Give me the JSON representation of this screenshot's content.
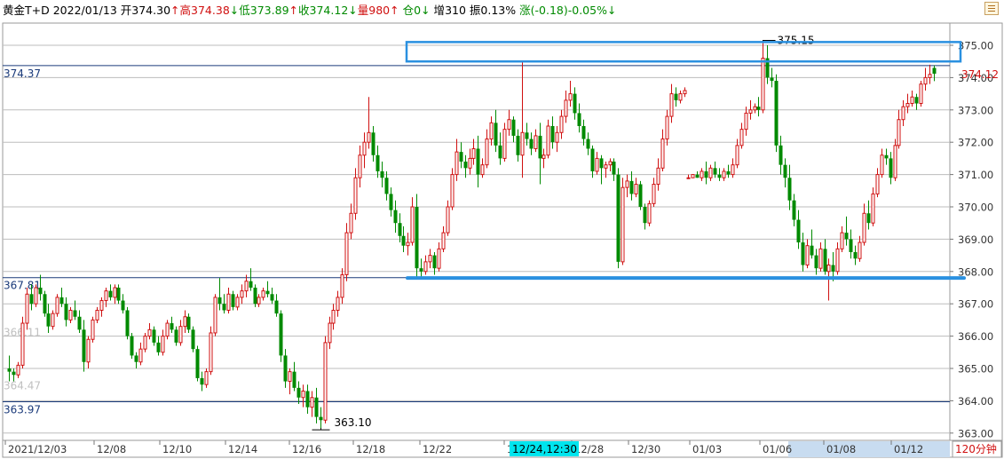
{
  "header": {
    "instrument": "黄金T+D",
    "date": "2022/01/13",
    "open_label": "开",
    "open_value": "374.30",
    "open_arrow": "↑",
    "high_label": "高",
    "high_value": "374.38",
    "high_arrow": "↓",
    "low_label": "低",
    "low_value": "373.89",
    "low_arrow": "↑",
    "close_label": "收",
    "close_value": "374.12",
    "close_arrow": "↓",
    "volume_label": "量",
    "volume_value": "980",
    "volume_arrow": "↑",
    "oi_label": "仓",
    "oi_value": "0",
    "oi_arrow": "↓",
    "increase_label": "增",
    "increase_value": "310",
    "amplitude_label": "振",
    "amplitude_value": "0.13%",
    "change_label": "涨",
    "change_value": "(-0.18)-0.05%",
    "change_arrow": "↓"
  },
  "period_label": "120分钟",
  "crosshair_time_label": "12/24,12:30",
  "colors": {
    "up": "#d01010",
    "down": "#008a00",
    "grid": "#bdbdbd",
    "ref_line": "#1a3a7a",
    "annotation": "#2a90e0",
    "axis_highlight": "#00e5ee",
    "axis_band": "#c8dcf0"
  },
  "chart_data": {
    "type": "candlestick",
    "y_ticks": [
      "375.00",
      "374.00",
      "373.00",
      "372.00",
      "371.00",
      "370.00",
      "369.00",
      "368.00",
      "367.00",
      "366.00",
      "365.00",
      "364.00",
      "363.00"
    ],
    "ylim": [
      362.8,
      375.9
    ],
    "x_tick_labels": [
      "2021/12/03",
      "12/08",
      "12/10",
      "12/14",
      "12/16",
      "12/18",
      "12/22",
      "12/24",
      "12/28",
      "12/30",
      "01/03",
      "01/06",
      "01/08",
      "01/12"
    ],
    "current_price": "374.12",
    "reference_lines": [
      {
        "value": 374.37,
        "label": "374.37"
      },
      {
        "value": 367.81,
        "label": "367.81"
      },
      {
        "value": 363.97,
        "label": "363.97"
      }
    ],
    "faded_labels": [
      {
        "value": 366.11,
        "label": "366.11"
      },
      {
        "value": 364.47,
        "label": "364.47"
      }
    ],
    "annotations": [
      {
        "kind": "box",
        "y_low": 374.5,
        "y_high": 375.1
      },
      {
        "kind": "line",
        "value": 367.8
      }
    ],
    "price_marks": [
      {
        "label": "375.15",
        "value": 375.15
      },
      {
        "label": "363.10",
        "value": 363.1
      }
    ],
    "candles": [
      [
        365.0,
        365.4,
        364.6,
        364.9
      ],
      [
        364.9,
        365.0,
        364.6,
        364.8
      ],
      [
        364.8,
        365.2,
        364.7,
        365.1
      ],
      [
        365.1,
        366.6,
        365.0,
        366.4
      ],
      [
        366.4,
        367.5,
        366.2,
        367.3
      ],
      [
        367.3,
        367.6,
        366.8,
        367.0
      ],
      [
        367.0,
        367.6,
        366.9,
        367.5
      ],
      [
        367.5,
        367.9,
        367.1,
        367.3
      ],
      [
        367.3,
        367.4,
        366.6,
        366.7
      ],
      [
        366.7,
        367.0,
        366.1,
        366.3
      ],
      [
        366.3,
        366.8,
        366.2,
        366.7
      ],
      [
        366.7,
        367.3,
        366.6,
        367.2
      ],
      [
        367.2,
        367.5,
        366.9,
        367.0
      ],
      [
        367.0,
        367.2,
        366.3,
        366.5
      ],
      [
        366.5,
        366.9,
        366.4,
        366.8
      ],
      [
        366.8,
        367.1,
        366.5,
        366.6
      ],
      [
        366.6,
        366.8,
        366.1,
        366.2
      ],
      [
        366.2,
        366.5,
        364.9,
        365.2
      ],
      [
        365.2,
        366.0,
        365.0,
        365.9
      ],
      [
        365.9,
        366.6,
        365.8,
        366.5
      ],
      [
        366.5,
        366.9,
        366.4,
        366.8
      ],
      [
        366.8,
        367.2,
        366.6,
        367.1
      ],
      [
        367.1,
        367.5,
        366.9,
        367.4
      ],
      [
        367.4,
        367.6,
        367.1,
        367.2
      ],
      [
        367.2,
        367.6,
        367.0,
        367.5
      ],
      [
        367.5,
        367.6,
        367.0,
        367.1
      ],
      [
        367.1,
        367.3,
        366.7,
        366.8
      ],
      [
        366.8,
        366.9,
        365.9,
        366.0
      ],
      [
        366.0,
        366.1,
        365.3,
        365.4
      ],
      [
        365.4,
        365.5,
        365.0,
        365.2
      ],
      [
        365.2,
        365.8,
        365.1,
        365.6
      ],
      [
        365.6,
        366.1,
        365.5,
        366.0
      ],
      [
        366.0,
        366.4,
        365.9,
        366.2
      ],
      [
        366.2,
        366.3,
        365.7,
        365.8
      ],
      [
        365.8,
        366.0,
        365.4,
        365.5
      ],
      [
        365.5,
        366.2,
        365.4,
        366.0
      ],
      [
        366.0,
        366.5,
        365.9,
        366.4
      ],
      [
        366.4,
        366.6,
        366.1,
        366.2
      ],
      [
        366.2,
        366.3,
        365.7,
        365.8
      ],
      [
        365.8,
        366.5,
        365.7,
        366.3
      ],
      [
        366.3,
        366.8,
        366.1,
        366.6
      ],
      [
        366.6,
        366.7,
        366.1,
        366.2
      ],
      [
        366.2,
        366.3,
        365.5,
        365.6
      ],
      [
        365.6,
        365.7,
        364.6,
        364.7
      ],
      [
        364.7,
        364.9,
        364.3,
        364.5
      ],
      [
        364.5,
        365.0,
        364.4,
        364.9
      ],
      [
        364.9,
        366.3,
        364.8,
        366.1
      ],
      [
        366.1,
        367.3,
        366.0,
        367.2
      ],
      [
        367.2,
        367.8,
        366.8,
        367.0
      ],
      [
        367.0,
        367.3,
        366.7,
        366.8
      ],
      [
        366.8,
        367.5,
        366.7,
        367.3
      ],
      [
        367.3,
        367.4,
        366.8,
        366.9
      ],
      [
        366.9,
        367.3,
        366.8,
        367.2
      ],
      [
        367.2,
        367.6,
        367.0,
        367.4
      ],
      [
        367.4,
        367.9,
        367.2,
        367.7
      ],
      [
        367.7,
        368.1,
        367.4,
        367.5
      ],
      [
        367.5,
        367.6,
        366.9,
        367.0
      ],
      [
        367.0,
        367.3,
        366.9,
        367.2
      ],
      [
        367.2,
        367.5,
        367.1,
        367.4
      ],
      [
        367.4,
        367.7,
        367.2,
        367.3
      ],
      [
        367.3,
        367.5,
        367.0,
        367.1
      ],
      [
        367.1,
        367.3,
        366.6,
        366.7
      ],
      [
        366.7,
        366.8,
        365.2,
        365.4
      ],
      [
        365.4,
        365.6,
        364.4,
        364.6
      ],
      [
        364.6,
        365.0,
        364.2,
        364.9
      ],
      [
        364.9,
        365.2,
        364.3,
        364.4
      ],
      [
        364.4,
        364.6,
        363.9,
        364.1
      ],
      [
        364.1,
        364.5,
        363.8,
        364.3
      ],
      [
        364.3,
        364.5,
        363.6,
        363.8
      ],
      [
        363.8,
        364.3,
        363.5,
        364.1
      ],
      [
        364.1,
        364.4,
        363.3,
        363.5
      ],
      [
        363.5,
        363.8,
        363.1,
        363.4
      ],
      [
        363.4,
        366.0,
        363.3,
        365.8
      ],
      [
        365.8,
        366.6,
        365.6,
        366.4
      ],
      [
        366.4,
        367.0,
        366.2,
        366.8
      ],
      [
        366.8,
        367.4,
        366.6,
        367.2
      ],
      [
        367.2,
        368.1,
        367.0,
        367.9
      ],
      [
        367.9,
        369.5,
        367.7,
        369.2
      ],
      [
        369.2,
        370.1,
        369.0,
        369.8
      ],
      [
        369.8,
        371.2,
        369.6,
        370.9
      ],
      [
        370.9,
        371.9,
        370.6,
        371.6
      ],
      [
        371.6,
        372.3,
        371.2,
        372.0
      ],
      [
        372.0,
        373.4,
        371.8,
        372.3
      ],
      [
        372.3,
        372.5,
        371.4,
        371.6
      ],
      [
        371.6,
        371.9,
        370.9,
        371.1
      ],
      [
        371.1,
        371.4,
        370.6,
        370.9
      ],
      [
        370.9,
        371.1,
        370.2,
        370.4
      ],
      [
        370.4,
        370.6,
        369.7,
        369.9
      ],
      [
        369.9,
        370.2,
        369.2,
        369.5
      ],
      [
        369.5,
        369.8,
        368.9,
        369.1
      ],
      [
        369.1,
        369.4,
        368.6,
        368.8
      ],
      [
        368.8,
        369.2,
        368.5,
        368.9
      ],
      [
        368.9,
        370.3,
        368.8,
        370.0
      ],
      [
        370.0,
        370.4,
        367.8,
        368.1
      ],
      [
        368.1,
        368.4,
        367.8,
        368.0
      ],
      [
        368.0,
        368.5,
        367.9,
        368.3
      ],
      [
        368.3,
        368.7,
        368.1,
        368.5
      ],
      [
        368.5,
        368.6,
        367.9,
        368.1
      ],
      [
        368.1,
        368.9,
        368.0,
        368.7
      ],
      [
        368.7,
        369.4,
        368.6,
        369.2
      ],
      [
        369.2,
        370.2,
        369.1,
        370.0
      ],
      [
        370.0,
        371.2,
        369.9,
        371.0
      ],
      [
        371.0,
        372.1,
        370.8,
        371.7
      ],
      [
        371.7,
        372.0,
        371.2,
        371.4
      ],
      [
        371.4,
        371.6,
        370.9,
        371.2
      ],
      [
        371.2,
        371.8,
        371.0,
        371.5
      ],
      [
        371.5,
        372.1,
        371.3,
        371.8
      ],
      [
        371.8,
        372.2,
        370.6,
        371.0
      ],
      [
        371.0,
        371.5,
        370.9,
        371.3
      ],
      [
        371.3,
        372.4,
        371.2,
        372.1
      ],
      [
        372.1,
        372.8,
        371.9,
        372.6
      ],
      [
        372.6,
        373.0,
        371.7,
        371.9
      ],
      [
        371.9,
        372.3,
        371.3,
        371.5
      ],
      [
        371.5,
        372.6,
        371.4,
        372.4
      ],
      [
        372.4,
        373.0,
        372.2,
        372.7
      ],
      [
        372.7,
        372.8,
        372.0,
        372.2
      ],
      [
        372.2,
        372.4,
        371.4,
        371.6
      ],
      [
        371.6,
        374.5,
        370.9,
        372.3
      ],
      [
        372.3,
        372.6,
        371.9,
        372.1
      ],
      [
        372.1,
        372.3,
        371.6,
        371.8
      ],
      [
        371.8,
        372.4,
        371.7,
        372.2
      ],
      [
        372.2,
        372.6,
        370.7,
        371.5
      ],
      [
        371.5,
        371.8,
        371.2,
        371.6
      ],
      [
        371.6,
        372.7,
        371.5,
        372.5
      ],
      [
        372.5,
        372.8,
        371.8,
        372.0
      ],
      [
        372.0,
        372.5,
        371.7,
        372.3
      ],
      [
        372.3,
        373.0,
        372.1,
        372.8
      ],
      [
        372.8,
        373.6,
        372.6,
        373.3
      ],
      [
        373.3,
        373.9,
        373.1,
        373.5
      ],
      [
        373.5,
        373.7,
        372.7,
        372.9
      ],
      [
        372.9,
        373.2,
        372.3,
        372.5
      ],
      [
        372.5,
        372.7,
        371.9,
        372.1
      ],
      [
        372.1,
        372.3,
        371.6,
        371.8
      ],
      [
        371.8,
        371.9,
        370.9,
        371.1
      ],
      [
        371.1,
        371.7,
        371.0,
        371.5
      ],
      [
        371.5,
        371.6,
        370.7,
        371.2
      ],
      [
        371.2,
        371.4,
        370.9,
        371.3
      ],
      [
        371.3,
        371.5,
        371.1,
        371.4
      ],
      [
        371.4,
        371.5,
        370.8,
        371.0
      ],
      [
        371.0,
        371.2,
        368.1,
        368.3
      ],
      [
        368.3,
        370.9,
        368.2,
        370.6
      ],
      [
        370.6,
        371.0,
        370.3,
        370.8
      ],
      [
        370.8,
        371.1,
        370.2,
        370.4
      ],
      [
        370.4,
        370.9,
        370.3,
        370.7
      ],
      [
        370.7,
        370.8,
        369.9,
        370.0
      ],
      [
        370.0,
        370.1,
        369.3,
        369.5
      ],
      [
        369.5,
        370.2,
        369.4,
        370.1
      ],
      [
        370.1,
        370.9,
        370.0,
        370.7
      ],
      [
        370.7,
        371.5,
        370.5,
        371.2
      ],
      [
        371.2,
        372.4,
        371.1,
        372.1
      ],
      [
        372.1,
        373.0,
        371.9,
        372.8
      ],
      [
        372.8,
        373.8,
        372.6,
        373.5
      ],
      [
        373.5,
        373.7,
        373.1,
        373.3
      ],
      [
        373.3,
        373.6,
        373.2,
        373.5
      ],
      [
        373.5,
        373.7,
        373.4,
        373.6
      ],
      [
        370.9,
        371.0,
        370.9,
        370.9
      ],
      [
        370.9,
        371.0,
        370.9,
        371.0
      ],
      [
        371.0,
        371.1,
        370.9,
        370.9
      ],
      [
        370.9,
        371.2,
        370.8,
        371.1
      ],
      [
        371.1,
        371.4,
        370.7,
        370.9
      ],
      [
        370.9,
        371.3,
        370.8,
        371.2
      ],
      [
        371.2,
        371.4,
        370.9,
        371.0
      ],
      [
        371.0,
        371.2,
        370.8,
        370.9
      ],
      [
        370.9,
        371.2,
        370.8,
        371.1
      ],
      [
        371.1,
        371.3,
        370.9,
        371.0
      ],
      [
        371.0,
        371.5,
        370.9,
        371.3
      ],
      [
        371.3,
        372.1,
        371.2,
        371.9
      ],
      [
        371.9,
        372.6,
        371.8,
        372.4
      ],
      [
        372.4,
        373.1,
        372.2,
        372.9
      ],
      [
        372.9,
        373.3,
        372.7,
        373.0
      ],
      [
        373.0,
        373.2,
        372.9,
        373.1
      ],
      [
        373.1,
        373.4,
        372.8,
        373.0
      ],
      [
        373.0,
        375.15,
        372.9,
        374.6
      ],
      [
        374.6,
        375.0,
        373.8,
        374.0
      ],
      [
        374.0,
        374.3,
        373.7,
        373.9
      ],
      [
        373.9,
        374.1,
        371.7,
        371.9
      ],
      [
        371.9,
        372.2,
        371.0,
        371.3
      ],
      [
        371.3,
        371.5,
        370.6,
        370.9
      ],
      [
        370.9,
        371.3,
        369.9,
        370.2
      ],
      [
        370.2,
        370.4,
        369.4,
        369.6
      ],
      [
        369.6,
        369.9,
        368.7,
        368.9
      ],
      [
        368.9,
        369.2,
        368.0,
        368.2
      ],
      [
        368.2,
        369.0,
        368.1,
        368.8
      ],
      [
        368.8,
        369.3,
        368.4,
        368.5
      ],
      [
        368.5,
        368.7,
        367.9,
        368.1
      ],
      [
        368.1,
        368.9,
        368.0,
        368.7
      ],
      [
        368.7,
        369.0,
        367.9,
        368.0
      ],
      [
        368.0,
        368.4,
        367.1,
        368.2
      ],
      [
        368.2,
        368.6,
        367.7,
        368.0
      ],
      [
        368.0,
        368.9,
        367.9,
        368.7
      ],
      [
        368.7,
        369.4,
        368.6,
        369.2
      ],
      [
        369.2,
        369.7,
        368.8,
        369.0
      ],
      [
        369.0,
        369.3,
        368.4,
        368.6
      ],
      [
        368.6,
        368.8,
        368.2,
        368.4
      ],
      [
        368.4,
        369.1,
        368.3,
        368.9
      ],
      [
        368.9,
        370.1,
        368.8,
        369.8
      ],
      [
        369.8,
        370.2,
        369.3,
        369.5
      ],
      [
        369.5,
        370.6,
        369.4,
        370.4
      ],
      [
        370.4,
        371.2,
        370.3,
        371.0
      ],
      [
        371.0,
        371.8,
        370.9,
        371.6
      ],
      [
        371.6,
        371.8,
        371.3,
        371.5
      ],
      [
        371.5,
        371.7,
        370.7,
        370.9
      ],
      [
        370.9,
        372.1,
        370.8,
        371.9
      ],
      [
        371.9,
        373.0,
        371.8,
        372.7
      ],
      [
        372.7,
        373.3,
        372.5,
        373.1
      ],
      [
        373.1,
        373.5,
        372.9,
        373.2
      ],
      [
        373.2,
        373.6,
        373.1,
        373.4
      ],
      [
        373.4,
        373.5,
        373.0,
        373.2
      ],
      [
        373.2,
        373.9,
        373.1,
        373.8
      ],
      [
        373.8,
        374.3,
        373.6,
        374.0
      ],
      [
        374.0,
        374.4,
        373.8,
        374.1
      ],
      [
        374.3,
        374.38,
        373.89,
        374.12
      ]
    ]
  }
}
